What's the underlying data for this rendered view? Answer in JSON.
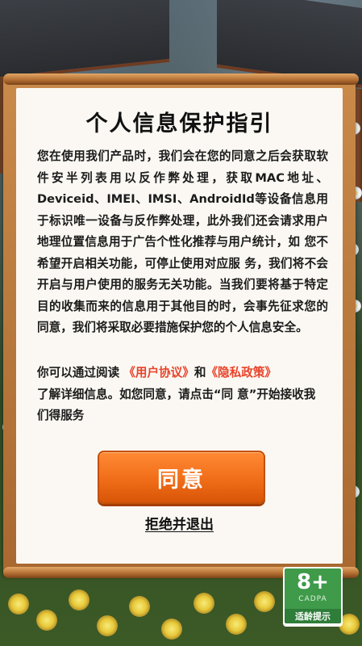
{
  "dialog": {
    "title": "个人信息保护指引",
    "body": "您在使用我们产品时，我们会在您的同意之后会获取软件安半列表用以反作弊处理，获取MAC地址、Deviceid、IMEI、IMSI、AndroidId等设备信息用于标识唯一设备与反作弊处理，此外我们还会请求用户地理位置信息用于广告个性化推荐与用户统计，如 您不希望开启相关功能，可停止使用对应服 务，我们将不会开启与用户使用的服务无关功能。当我们要将基于特定目的收集而来的信息用于其他目的时，会事先征求您的同意，我们将采取必要措施保护您的个人信息安全。",
    "read_prefix": "你可以通过阅读",
    "user_agreement_link": "《用户协议》",
    "and_text": "和",
    "privacy_policy_link": "《隐私政策》",
    "read_suffix": "了解详细信息。如您同意，请点击“同 意”开始接收我们得服务",
    "agree_label": "同意",
    "reject_label": "拒绝并退出"
  },
  "age_rating": {
    "number": "8+",
    "org": "CADPA",
    "label": "适龄提示",
    "color": "#3f9a4a"
  },
  "colors": {
    "accent": "#f06d18",
    "link": "#e8432a",
    "panel": "#fbf8f3",
    "frame": "#b06b30"
  }
}
